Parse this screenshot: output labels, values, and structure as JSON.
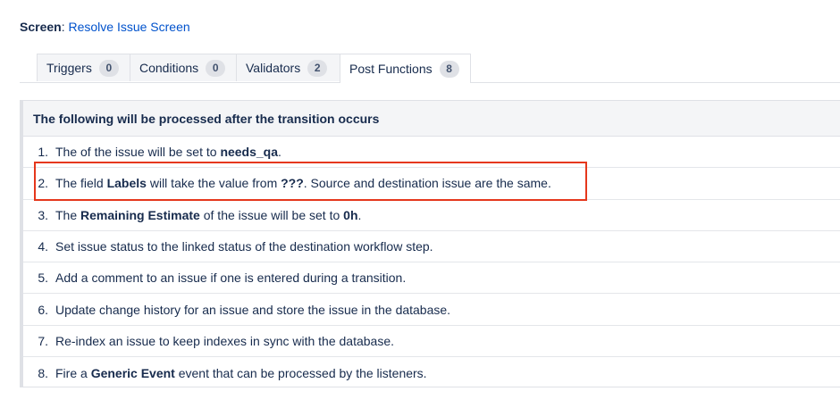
{
  "screen": {
    "label": "Screen",
    "value": "Resolve Issue Screen"
  },
  "tabs": [
    {
      "label": "Triggers",
      "count": "0"
    },
    {
      "label": "Conditions",
      "count": "0"
    },
    {
      "label": "Validators",
      "count": "2"
    },
    {
      "label": "Post Functions",
      "count": "8"
    }
  ],
  "panel": {
    "header": "The following will be processed after the transition occurs",
    "items": [
      {
        "num": "1.",
        "p1": "The of the issue will be set to ",
        "b1": "needs_qa",
        "p2": "."
      },
      {
        "num": "2.",
        "p1": "The field ",
        "b1": "Labels",
        "p2": " will take the value from ",
        "b2": "???",
        "p3": ". Source and destination issue are the same."
      },
      {
        "num": "3.",
        "p1": "The ",
        "b1": "Remaining Estimate",
        "p2": " of the issue will be set to ",
        "b2": "0h",
        "p3": "."
      },
      {
        "num": "4.",
        "p1": "Set issue status to the linked status of the destination workflow step."
      },
      {
        "num": "5.",
        "p1": "Add a comment to an issue if one is entered during a transition."
      },
      {
        "num": "6.",
        "p1": "Update change history for an issue and store the issue in the database."
      },
      {
        "num": "7.",
        "p1": "Re-index an issue to keep indexes in sync with the database."
      },
      {
        "num": "8.",
        "p1": "Fire a ",
        "b1": "Generic Event",
        "p2": " event that can be processed by the listeners."
      }
    ]
  },
  "colors": {
    "highlight": "#e5371c",
    "link": "#0052cc"
  }
}
